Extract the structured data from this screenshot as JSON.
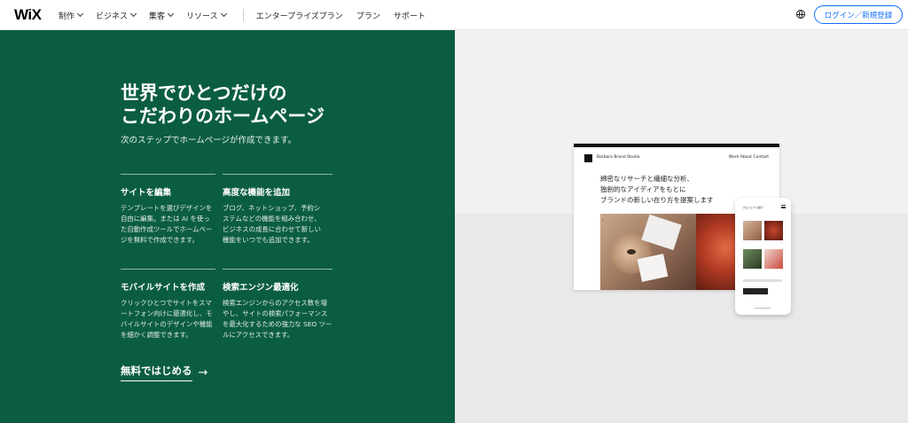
{
  "nav": {
    "logo": "WiX",
    "menu": [
      {
        "label": "制作"
      },
      {
        "label": "ビジネス"
      },
      {
        "label": "集客"
      },
      {
        "label": "リソース"
      }
    ],
    "links": [
      {
        "label": "エンタープライズプラン"
      },
      {
        "label": "プラン"
      },
      {
        "label": "サポート"
      }
    ],
    "globe_icon": "globe-icon",
    "login_label": "ログイン／新規登録",
    "accent": "#116dff"
  },
  "hero": {
    "title_line1": "世界でひとつだけの",
    "title_line2": "こだわりのホームページ",
    "subtitle": "次のステップでホームページが作成できます。",
    "background": "#0b5d41",
    "features": [
      {
        "title": "サイトを編集",
        "text": "テンプレートを選びデザインを\n自由に編集。または AI を使っ\nた自動作成ツールでホームペー\nジを無料で作成できます。"
      },
      {
        "title": "高度な機能を追加",
        "text": "ブログ、ネットショップ、予約シ\nステムなどの機能を組み合わせ、\nビジネスの成長に合わせて新しい\n機能をいつでも追加できます。"
      },
      {
        "title": "モバイルサイトを作成",
        "text": "クリックひとつでサイトをスマ\nートフォン向けに最適化し、モ\nバイルサイトのデザインや機能\nを細かく調整できます。"
      },
      {
        "title": "検索エンジン最適化",
        "text": "検索エンジンからのアクセス数を増\nやし、サイトの検索パフォーマンス\nを最大化するための強力な SEO ツー\nルにアクセスできます。"
      }
    ],
    "cta_label": "無料ではじめる",
    "cta_arrow": "→"
  },
  "showcase": {
    "desktop": {
      "brand": "Barbara Brand Studio",
      "links": "Work  About  Contact",
      "copy": "綿密なリサーチと繊細な分析、\n独創的なアイディアをもとに\nブランドの新しい在り方を提案します",
      "arrow_left": "‹",
      "arrow_right": "›"
    },
    "phone": {
      "title": "プロジェクト紹介"
    }
  }
}
